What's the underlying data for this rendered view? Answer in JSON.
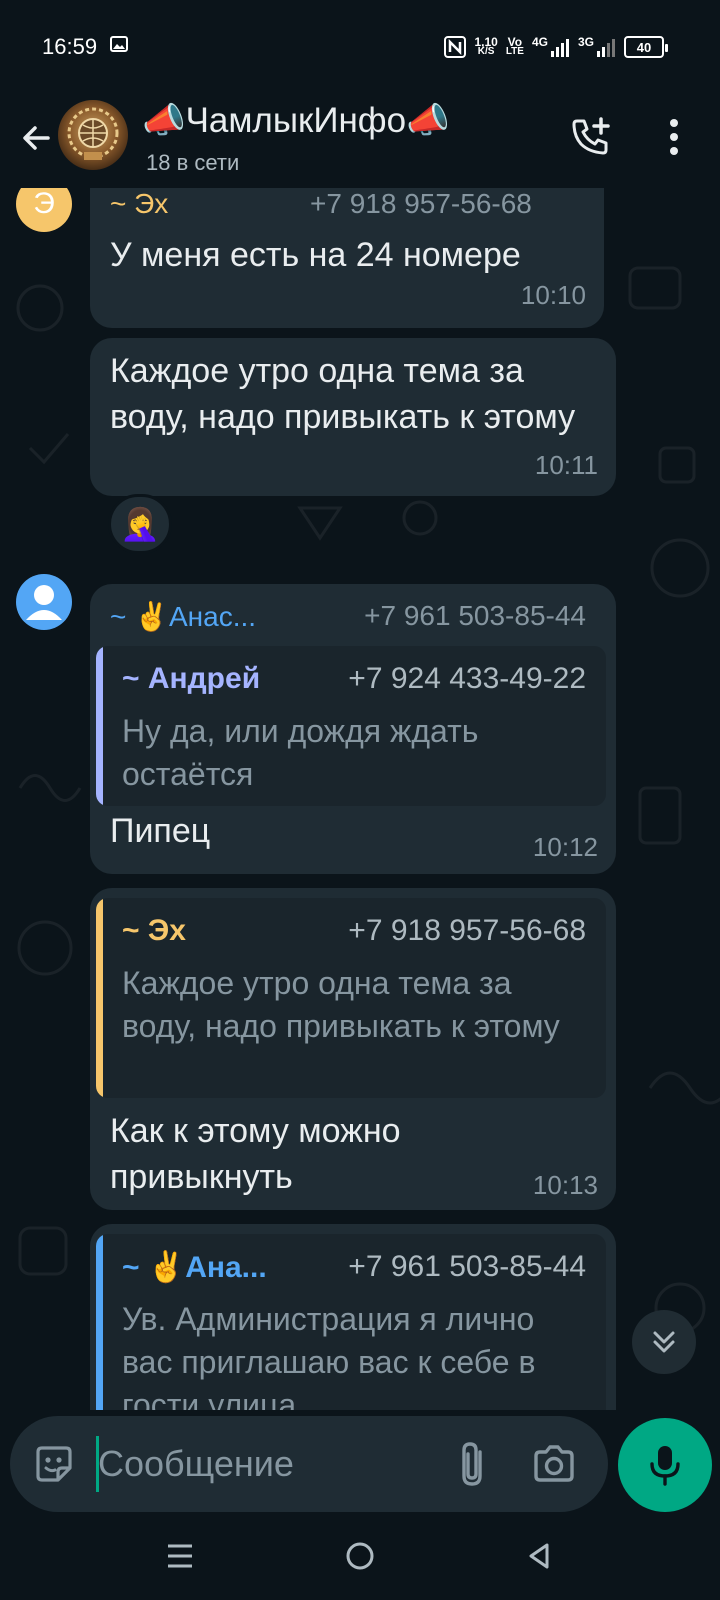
{
  "status_bar": {
    "time": "16:59",
    "net_speed_value": "1,10",
    "net_speed_unit": "K/S",
    "volte_top": "Vo",
    "volte_bottom": "LTE",
    "network_1": "4G",
    "network_2": "3G",
    "battery": "40"
  },
  "header": {
    "title": "📣ЧамлыкИнфо📣",
    "subtitle": "18 в сети"
  },
  "messages": [
    {
      "sender_avatar_letter": "Э",
      "sender": "~ Эх",
      "phone": "+7 918 957-56-68",
      "text": "У меня есть на 24 номере",
      "time": "10:10"
    },
    {
      "text": "Каждое утро одна тема за воду, надо привыкать к этому",
      "time": "10:11",
      "reaction": "🤦‍♀️"
    },
    {
      "sender": "~ ✌️Анас...",
      "phone": "+7 961 503-85-44",
      "quote": {
        "name": "~ Андрей",
        "phone": "+7 924 433-49-22",
        "text": "Ну да, или дождя ждать остаётся"
      },
      "text": "Пипец",
      "time": "10:12"
    },
    {
      "quote": {
        "name": "~ Эх",
        "phone": "+7 918 957-56-68",
        "text": "Каждое утро одна тема за воду, надо привыкать к этому"
      },
      "text": "Как к этому можно привыкнуть",
      "time": "10:13"
    },
    {
      "quote": {
        "name": "~ ✌️Ана...",
        "phone": "+7 961 503-85-44",
        "text": "Ув. Администрация я лично вас приглашаю вас к себе в гости улица"
      }
    }
  ],
  "composer": {
    "placeholder": "Сообщение"
  },
  "colors": {
    "accent": "#00a884",
    "bubble": "#1f2c34",
    "sender_eh": "#f6c66b",
    "sender_anas": "#53a6f5",
    "quote_andrey": "#a5b4ff"
  },
  "icons": [
    "back-arrow-icon",
    "add-call-icon",
    "more-vert-icon",
    "sticker-icon",
    "attach-icon",
    "camera-icon",
    "mic-icon",
    "scroll-down-icon",
    "nav-recents-icon",
    "nav-home-icon",
    "nav-back-icon"
  ]
}
